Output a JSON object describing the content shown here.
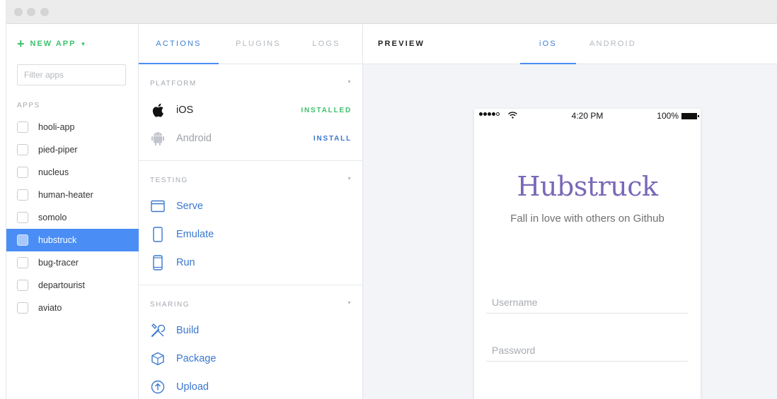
{
  "sidebar": {
    "new_app_label": "NEW APP",
    "filter_placeholder": "Filter apps",
    "apps_heading": "APPS",
    "apps": [
      "hooli-app",
      "pied-piper",
      "nucleus",
      "human-heater",
      "somolo",
      "hubstruck",
      "bug-tracer",
      "departourist",
      "aviato"
    ],
    "selected_app": "hubstruck"
  },
  "actions": {
    "tabs": [
      "ACTIONS",
      "PLUGINS",
      "LOGS"
    ],
    "active_tab": "ACTIONS",
    "platform": {
      "heading": "PLATFORM",
      "items": [
        {
          "label": "iOS",
          "status": "INSTALLED",
          "icon": "apple-icon"
        },
        {
          "label": "Android",
          "status": "INSTALL",
          "icon": "android-icon"
        }
      ]
    },
    "testing": {
      "heading": "TESTING",
      "items": [
        {
          "label": "Serve",
          "icon": "browser-window-icon"
        },
        {
          "label": "Emulate",
          "icon": "phone-outline-icon"
        },
        {
          "label": "Run",
          "icon": "phone-device-icon"
        }
      ]
    },
    "sharing": {
      "heading": "SHARING",
      "items": [
        {
          "label": "Build",
          "icon": "tools-icon"
        },
        {
          "label": "Package",
          "icon": "box-icon"
        },
        {
          "label": "Upload",
          "icon": "upload-icon"
        }
      ]
    }
  },
  "preview": {
    "title": "PREVIEW",
    "tabs": [
      "iOS",
      "ANDROID"
    ],
    "active_tab": "iOS",
    "statusbar": {
      "time": "4:20 PM",
      "battery": "100%"
    },
    "app_title": "Hubstruck",
    "app_subtitle": "Fall in love with others on Github",
    "username_placeholder": "Username",
    "password_placeholder": "Password"
  },
  "colors": {
    "accent_blue": "#4a8ef5",
    "installed_green": "#3ec16d",
    "brand_purple": "#7a68b8"
  }
}
